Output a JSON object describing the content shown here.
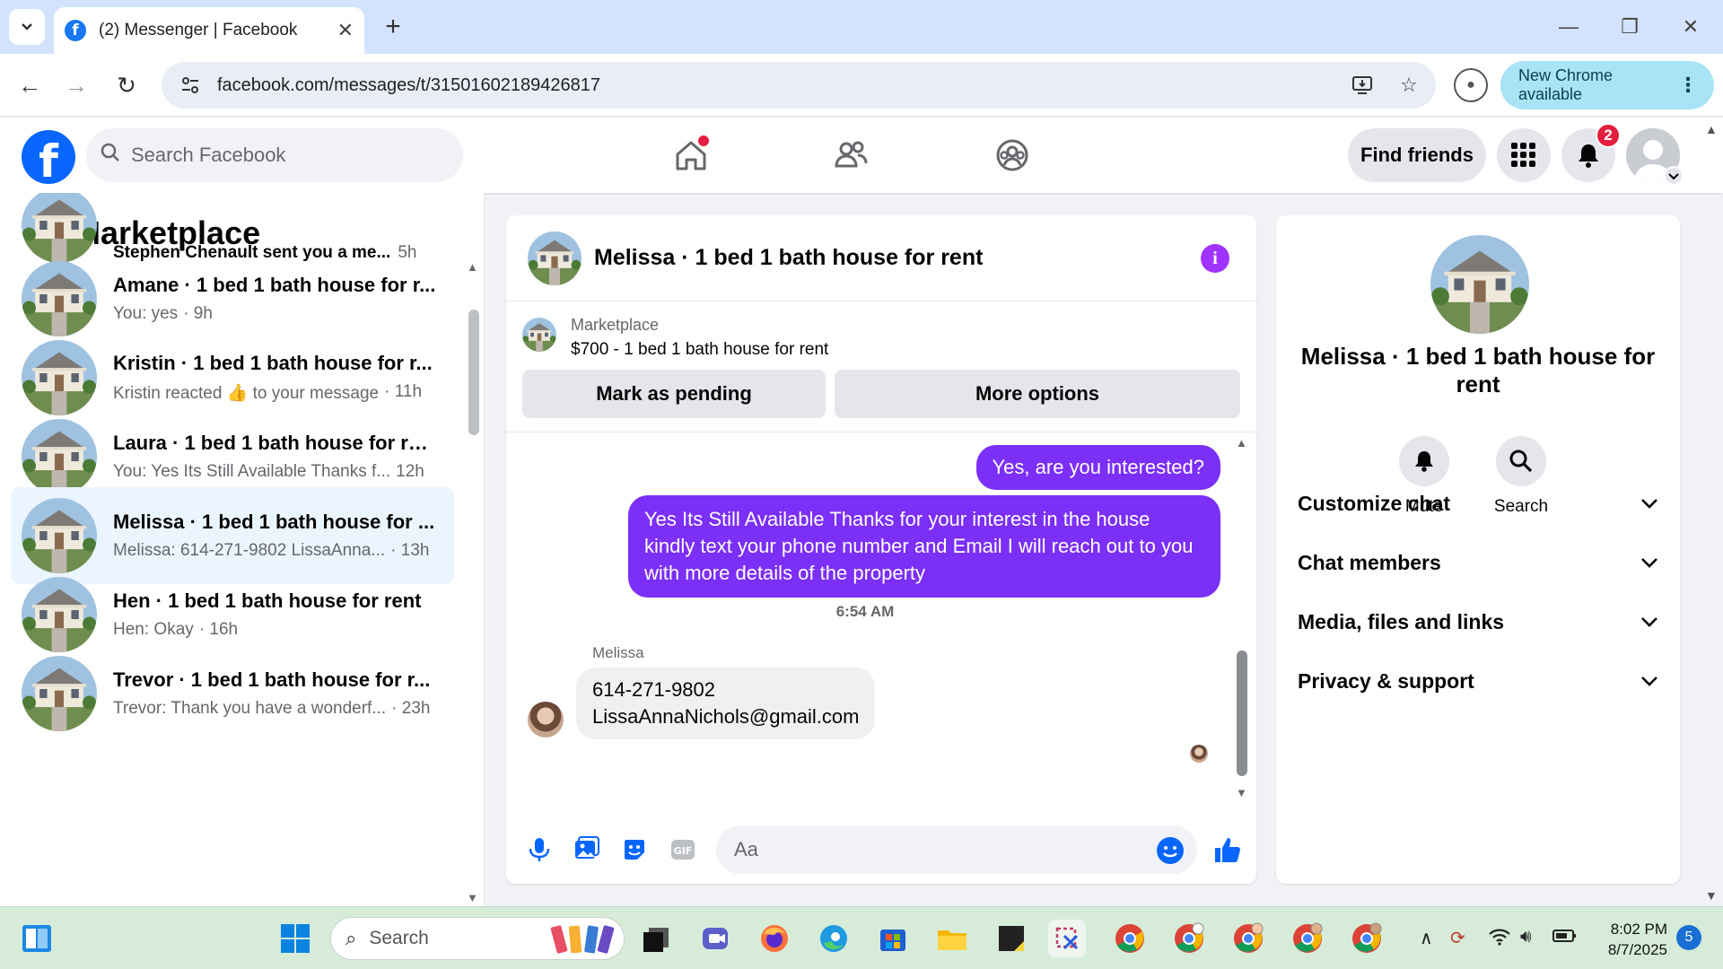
{
  "browser": {
    "tab_title": "(2) Messenger | Facebook",
    "url": "facebook.com/messages/t/31501602189426817",
    "update_label": "New Chrome available"
  },
  "fb_header": {
    "search_placeholder": "Search Facebook",
    "find_friends_label": "Find friends",
    "notification_count": "2"
  },
  "left_pane": {
    "title": "Marketplace",
    "conversations": [
      {
        "name": "Stephen Chenault sent you a me...",
        "preview": "",
        "time": "5h",
        "active": false
      },
      {
        "name": "Amane · 1 bed 1 bath house for r...",
        "preview": "You: yes",
        "time": "· 9h",
        "active": false
      },
      {
        "name": "Kristin · 1 bed 1 bath house for r...",
        "preview": "Kristin reacted 👍 to your message",
        "time": "· 11h",
        "active": false
      },
      {
        "name": "Laura · 1 bed 1 bath house for rent",
        "preview": "You: Yes Its Still Available Thanks f...",
        "time": "12h",
        "active": false
      },
      {
        "name": "Melissa · 1 bed 1 bath house for ...",
        "preview": "Melissa: 614-271-9802 LissaAnna...",
        "time": "· 13h",
        "active": true
      },
      {
        "name": "Hen · 1 bed 1 bath house for rent",
        "preview": "Hen: Okay",
        "time": "· 16h",
        "active": false
      },
      {
        "name": "Trevor · 1 bed 1 bath house for r...",
        "preview": "Trevor: Thank you have a wonderf...",
        "time": "· 23h",
        "active": false
      }
    ]
  },
  "chat": {
    "title": "Melissa · 1 bed 1 bath house for rent",
    "listing_source": "Marketplace",
    "listing_desc": "$700 - 1 bed 1 bath house for rent",
    "mark_pending_label": "Mark as pending",
    "more_options_label": "More options",
    "out_msg_1": "Yes, are you interested?",
    "out_msg_2": "Yes Its Still Available Thanks for your interest in the house kindly text your phone number and Email I will reach out to you with more details of the property",
    "timestamp": "6:54 AM",
    "in_sender": "Melissa",
    "in_msg_line1": "614-271-9802",
    "in_msg_line2": "LissaAnnaNichols@gmail.com",
    "input_placeholder": "Aa"
  },
  "info_pane": {
    "name": "Melissa · 1 bed 1 bath house for rent",
    "mute_label": "Mute",
    "search_label": "Search",
    "sections": [
      "Customize chat",
      "Chat members",
      "Media, files and links",
      "Privacy & support"
    ]
  },
  "taskbar": {
    "search_label": "Search",
    "time": "8:02 PM",
    "date": "8/7/2025",
    "notif_count": "5"
  },
  "colors": {
    "accent": "#0866ff",
    "out_bubble": "#7b2ff7",
    "active_row": "#ebf5ff"
  }
}
